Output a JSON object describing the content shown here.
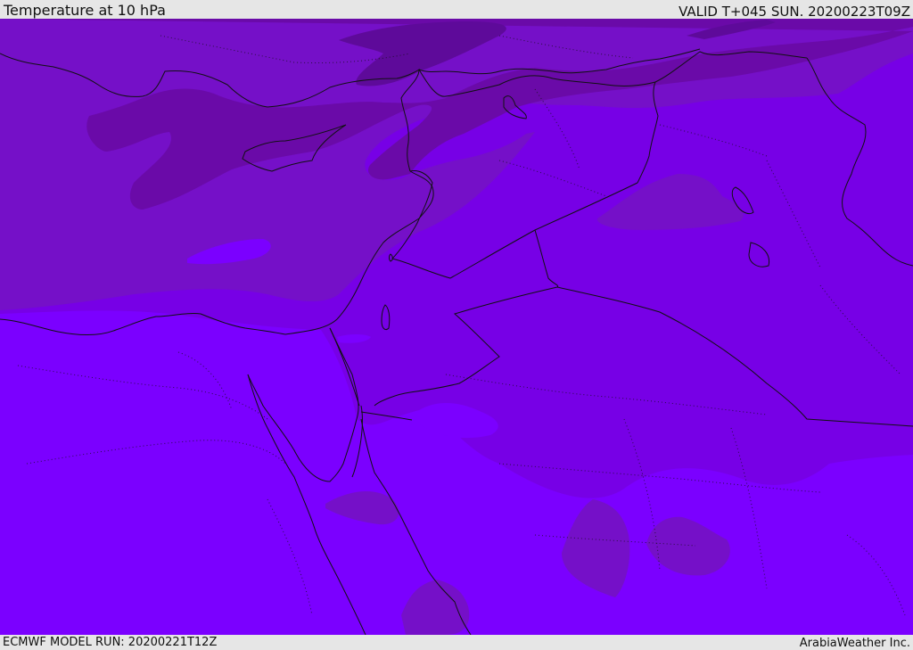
{
  "header": {
    "title": "Temperature at 10 hPa",
    "valid": "VALID T+045 SUN. 20200223T09Z"
  },
  "footer": {
    "model_run": "ECMWF MODEL RUN: 20200221T12Z",
    "credit": "ArabiaWeather Inc."
  },
  "map": {
    "region": "Eastern Mediterranean and Middle East",
    "colors": {
      "base": "#7b00ff",
      "band_mid": "#7700e6",
      "band_upper": "#7510c8",
      "band_cold": "#6a0aa8",
      "band_coldest": "#5e0a9a",
      "outline": "#111111"
    }
  }
}
